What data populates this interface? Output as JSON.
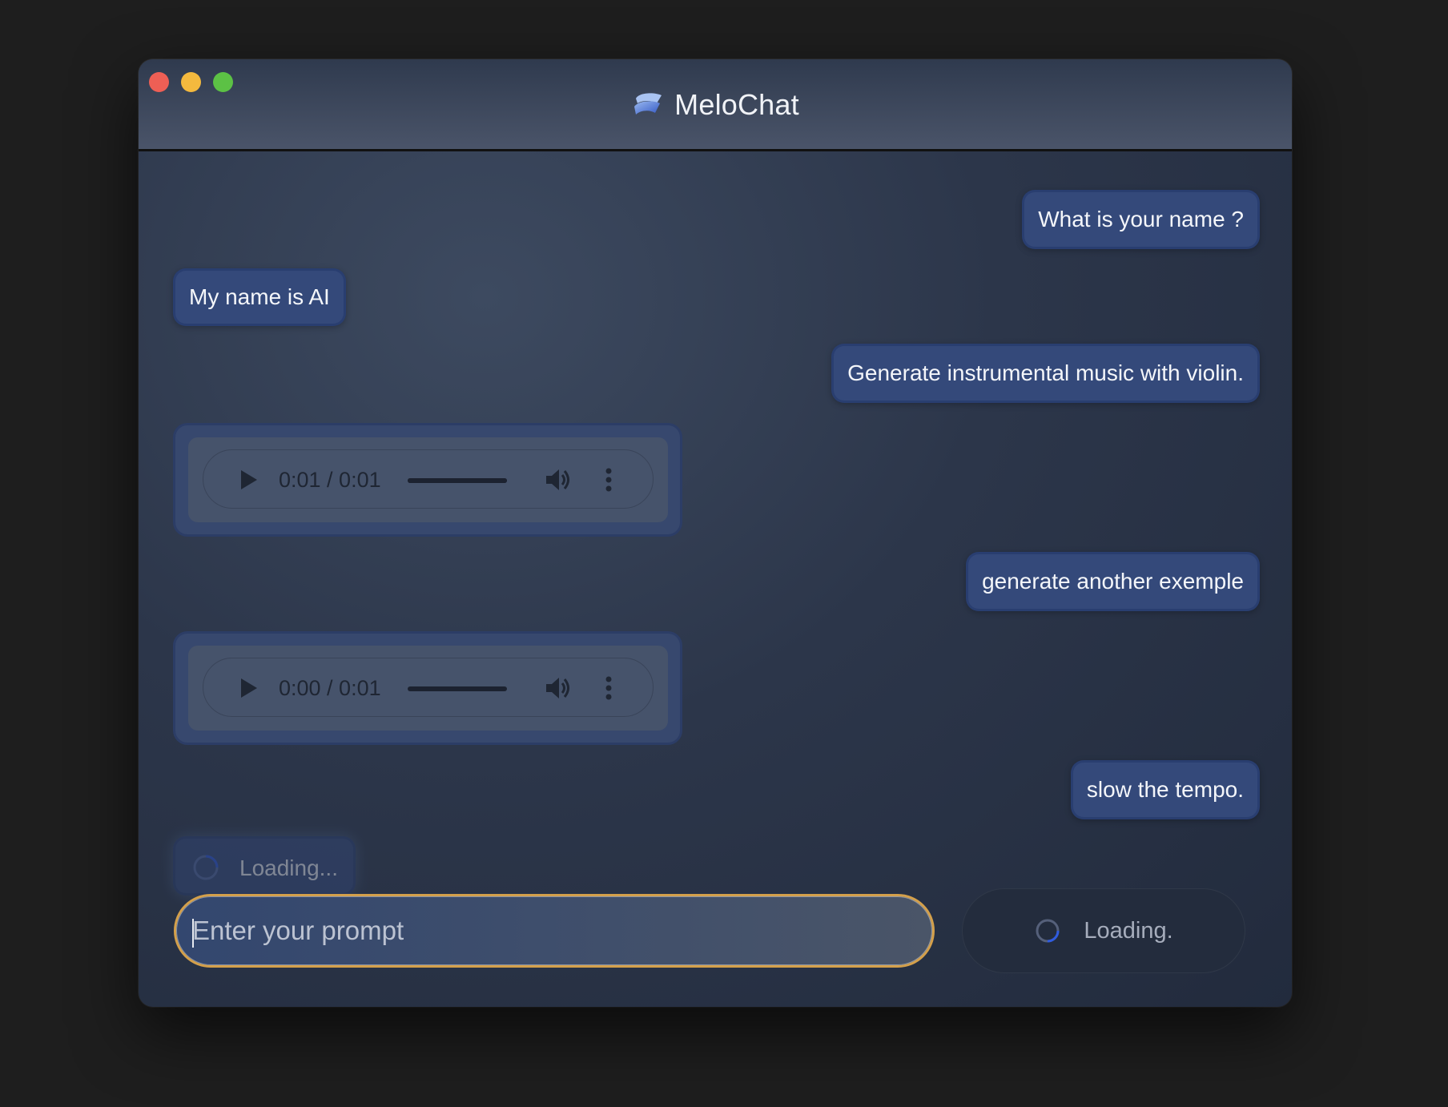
{
  "window": {
    "title": "MeloChat"
  },
  "messages": [
    {
      "role": "user",
      "text": "What is your name ?"
    },
    {
      "role": "assistant",
      "text": "My name is AI"
    },
    {
      "role": "user",
      "text": "Generate instrumental music with violin."
    },
    {
      "role": "assistant",
      "type": "audio",
      "time": "0:01 / 0:01",
      "progress": 1.0
    },
    {
      "role": "user",
      "text": "generate another exemple"
    },
    {
      "role": "assistant",
      "type": "audio",
      "time": "0:00 / 0:01",
      "progress": 0.0
    },
    {
      "role": "user",
      "text": "slow the tempo."
    },
    {
      "role": "assistant",
      "type": "loading",
      "text": "Loading..."
    }
  ],
  "composer": {
    "placeholder": "Enter your prompt",
    "value": "",
    "send_label": "Loading."
  },
  "icons": {
    "logo": "melochat-logo",
    "play": "play-icon",
    "volume": "volume-icon",
    "more": "more-vertical-icon",
    "spinner": "spinner-icon"
  },
  "colors": {
    "close": "#ee5f55",
    "minimize": "#f4b93e",
    "maximize": "#5cc145",
    "bubble": "#34497a",
    "prompt_border": "#d4a04b"
  }
}
